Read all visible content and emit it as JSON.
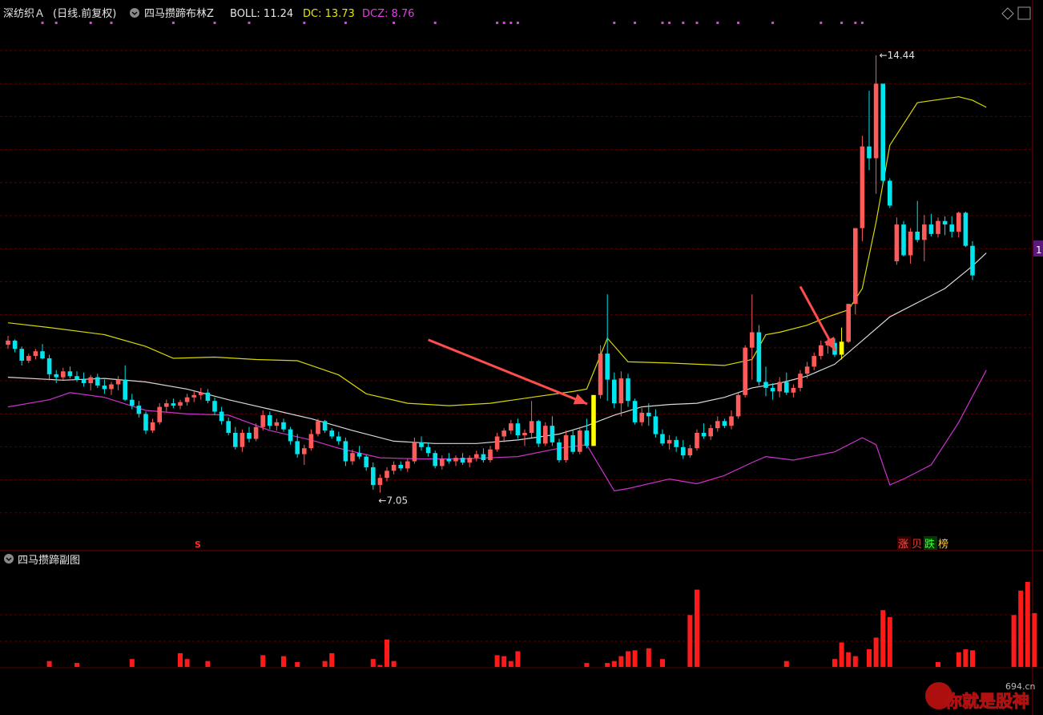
{
  "header": {
    "stock_name": "深纺织Ａ",
    "period": "(日线.前复权)",
    "indicator_name": "四马攒蹄布林Z",
    "boll_label": "BOLL: 11.24",
    "dc_label": "DC: 13.73",
    "dcz_label": "DCZ: 8.76"
  },
  "sub_panel": {
    "title": "四马攒蹄副图"
  },
  "annotations": {
    "high_label": "14.44",
    "low_label": "7.05",
    "signal_s": "S",
    "rank_labels": [
      "涨",
      "贝",
      "跌",
      "榜"
    ],
    "right_edge_label": "1"
  },
  "watermark": {
    "site": "694.cn",
    "text": "你就是股神"
  },
  "colors": {
    "background": "#000000",
    "up": "#ff5b5b",
    "down": "#00e5ee",
    "boll_mid": "#d8d8d8",
    "boll_upper": "#d8d800",
    "boll_lower": "#cc33cc",
    "grid": "#5a0000",
    "signal": "#ffff00",
    "volume": "#ff1a1a",
    "arrow": "#ff4d4d"
  },
  "chart_data": {
    "type": "candlestick",
    "title": "四马攒蹄布林Z",
    "ylim": [
      6.3,
      14.9
    ],
    "sub_ylim": [
      0,
      1
    ],
    "x": "trading day index",
    "candles": [
      [
        9.55,
        9.7,
        9.48,
        9.62
      ],
      [
        9.62,
        9.64,
        9.42,
        9.48
      ],
      [
        9.48,
        9.52,
        9.2,
        9.28
      ],
      [
        9.28,
        9.4,
        9.24,
        9.36
      ],
      [
        9.36,
        9.48,
        9.3,
        9.44
      ],
      [
        9.44,
        9.56,
        9.3,
        9.32
      ],
      [
        9.32,
        9.38,
        8.95,
        9.05
      ],
      [
        9.05,
        9.12,
        8.9,
        9.0
      ],
      [
        9.0,
        9.16,
        8.96,
        9.1
      ],
      [
        9.1,
        9.18,
        8.98,
        9.02
      ],
      [
        9.02,
        9.1,
        8.92,
        8.96
      ],
      [
        8.96,
        9.08,
        8.84,
        8.9
      ],
      [
        8.9,
        9.04,
        8.78,
        9.0
      ],
      [
        9.0,
        9.06,
        8.82,
        8.86
      ],
      [
        8.86,
        8.96,
        8.72,
        8.8
      ],
      [
        8.8,
        8.92,
        8.7,
        8.88
      ],
      [
        8.88,
        9.02,
        8.78,
        8.96
      ],
      [
        8.96,
        9.2,
        8.6,
        8.62
      ],
      [
        8.62,
        8.72,
        8.46,
        8.52
      ],
      [
        8.52,
        8.6,
        8.32,
        8.38
      ],
      [
        8.38,
        8.42,
        8.04,
        8.1
      ],
      [
        8.1,
        8.3,
        8.06,
        8.24
      ],
      [
        8.24,
        8.56,
        8.2,
        8.5
      ],
      [
        8.5,
        8.62,
        8.42,
        8.56
      ],
      [
        8.56,
        8.64,
        8.48,
        8.52
      ],
      [
        8.52,
        8.62,
        8.46,
        8.58
      ],
      [
        8.58,
        8.72,
        8.52,
        8.66
      ],
      [
        8.66,
        8.76,
        8.58,
        8.7
      ],
      [
        8.7,
        8.82,
        8.62,
        8.74
      ],
      [
        8.74,
        8.8,
        8.56,
        8.6
      ],
      [
        8.6,
        8.66,
        8.36,
        8.42
      ],
      [
        8.42,
        8.5,
        8.2,
        8.26
      ],
      [
        8.26,
        8.32,
        8.02,
        8.06
      ],
      [
        8.06,
        8.16,
        7.78,
        7.82
      ],
      [
        7.82,
        8.12,
        7.74,
        8.06
      ],
      [
        8.06,
        8.16,
        7.9,
        7.96
      ],
      [
        7.96,
        8.22,
        7.92,
        8.16
      ],
      [
        8.16,
        8.44,
        8.1,
        8.36
      ],
      [
        8.36,
        8.42,
        8.12,
        8.18
      ],
      [
        8.18,
        8.3,
        8.1,
        8.24
      ],
      [
        8.24,
        8.3,
        8.08,
        8.12
      ],
      [
        8.12,
        8.16,
        7.86,
        7.92
      ],
      [
        7.92,
        8.04,
        7.64,
        7.7
      ],
      [
        7.7,
        7.86,
        7.52,
        7.8
      ],
      [
        7.8,
        8.12,
        7.76,
        8.04
      ],
      [
        8.04,
        8.3,
        8.0,
        8.26
      ],
      [
        8.26,
        8.28,
        8.06,
        8.1
      ],
      [
        8.1,
        8.14,
        7.96,
        8.0
      ],
      [
        8.0,
        8.08,
        7.86,
        7.92
      ],
      [
        7.92,
        7.98,
        7.5,
        7.58
      ],
      [
        7.58,
        7.78,
        7.52,
        7.72
      ],
      [
        7.72,
        7.84,
        7.62,
        7.66
      ],
      [
        7.66,
        7.7,
        7.42,
        7.48
      ],
      [
        7.48,
        7.56,
        7.1,
        7.18
      ],
      [
        7.18,
        7.36,
        7.05,
        7.3
      ],
      [
        7.3,
        7.48,
        7.24,
        7.42
      ],
      [
        7.42,
        7.58,
        7.36,
        7.52
      ],
      [
        7.52,
        7.58,
        7.42,
        7.46
      ],
      [
        7.46,
        7.62,
        7.4,
        7.58
      ],
      [
        7.58,
        7.98,
        7.54,
        7.9
      ],
      [
        7.9,
        8.0,
        7.76,
        7.82
      ],
      [
        7.82,
        7.9,
        7.66,
        7.72
      ],
      [
        7.72,
        7.76,
        7.46,
        7.5
      ],
      [
        7.5,
        7.68,
        7.44,
        7.62
      ],
      [
        7.62,
        7.72,
        7.54,
        7.58
      ],
      [
        7.58,
        7.68,
        7.5,
        7.64
      ],
      [
        7.64,
        7.72,
        7.52,
        7.56
      ],
      [
        7.56,
        7.68,
        7.48,
        7.64
      ],
      [
        7.64,
        7.76,
        7.58,
        7.7
      ],
      [
        7.7,
        7.8,
        7.56,
        7.6
      ],
      [
        7.6,
        7.84,
        7.56,
        7.78
      ],
      [
        7.78,
        8.06,
        7.74,
        8.0
      ],
      [
        8.0,
        8.14,
        7.9,
        8.1
      ],
      [
        8.1,
        8.28,
        8.04,
        8.22
      ],
      [
        8.22,
        8.3,
        7.96,
        8.02
      ],
      [
        8.02,
        8.12,
        7.84,
        8.06
      ],
      [
        8.06,
        8.6,
        7.98,
        8.26
      ],
      [
        8.26,
        8.28,
        7.82,
        7.88
      ],
      [
        7.88,
        8.24,
        7.84,
        8.18
      ],
      [
        8.18,
        8.34,
        7.84,
        7.9
      ],
      [
        7.9,
        7.96,
        7.56,
        7.6
      ],
      [
        7.6,
        8.1,
        7.56,
        8.02
      ],
      [
        8.02,
        8.1,
        7.7,
        7.74
      ],
      [
        7.74,
        8.16,
        7.7,
        8.1
      ],
      [
        8.1,
        8.3,
        7.8,
        7.84
      ],
      [
        7.84,
        8.7,
        7.84,
        8.7
      ],
      [
        8.7,
        9.54,
        8.64,
        9.4
      ],
      [
        9.4,
        10.4,
        8.6,
        8.96
      ],
      [
        8.96,
        9.08,
        8.48,
        8.56
      ],
      [
        8.56,
        9.1,
        8.34,
        8.98
      ],
      [
        8.98,
        9.06,
        8.5,
        8.6
      ],
      [
        8.6,
        8.64,
        8.2,
        8.24
      ],
      [
        8.24,
        8.48,
        8.18,
        8.4
      ],
      [
        8.4,
        8.56,
        8.18,
        8.34
      ],
      [
        8.34,
        8.46,
        7.98,
        8.04
      ],
      [
        8.04,
        8.12,
        7.84,
        7.88
      ],
      [
        7.88,
        8.02,
        7.78,
        7.94
      ],
      [
        7.94,
        8.0,
        7.74,
        7.82
      ],
      [
        7.82,
        7.94,
        7.62,
        7.68
      ],
      [
        7.68,
        7.86,
        7.64,
        7.8
      ],
      [
        7.8,
        8.12,
        7.76,
        8.06
      ],
      [
        8.06,
        8.22,
        7.96,
        8.0
      ],
      [
        8.0,
        8.2,
        7.94,
        8.14
      ],
      [
        8.14,
        8.34,
        8.08,
        8.26
      ],
      [
        8.26,
        8.3,
        8.14,
        8.18
      ],
      [
        8.18,
        8.44,
        8.12,
        8.34
      ],
      [
        8.34,
        8.74,
        8.3,
        8.7
      ],
      [
        8.7,
        9.54,
        8.66,
        9.5
      ],
      [
        9.5,
        10.4,
        8.96,
        9.76
      ],
      [
        9.76,
        9.88,
        8.86,
        8.92
      ],
      [
        8.92,
        9.18,
        8.68,
        8.82
      ],
      [
        8.82,
        8.9,
        8.62,
        8.76
      ],
      [
        8.76,
        9.0,
        8.66,
        8.92
      ],
      [
        8.92,
        9.08,
        8.7,
        8.74
      ],
      [
        8.74,
        8.88,
        8.66,
        8.82
      ],
      [
        8.82,
        9.12,
        8.76,
        9.06
      ],
      [
        9.06,
        9.26,
        8.98,
        9.18
      ],
      [
        9.18,
        9.42,
        9.12,
        9.36
      ],
      [
        9.36,
        9.62,
        9.3,
        9.54
      ],
      [
        9.54,
        9.66,
        9.4,
        9.58
      ],
      [
        9.58,
        9.66,
        9.34,
        9.38
      ],
      [
        9.38,
        9.84,
        9.3,
        9.6
      ],
      [
        9.6,
        10.24,
        9.58,
        10.24
      ],
      [
        10.24,
        11.52,
        10.06,
        11.52
      ],
      [
        11.52,
        13.08,
        11.3,
        12.9
      ],
      [
        12.9,
        13.84,
        12.5,
        12.7
      ],
      [
        12.7,
        14.44,
        12.1,
        13.96
      ],
      [
        13.96,
        13.14,
        12.26,
        12.32
      ],
      [
        12.32,
        12.36,
        11.86,
        11.9
      ],
      [
        10.96,
        11.7,
        10.9,
        11.58
      ],
      [
        11.58,
        11.64,
        11.04,
        11.06
      ],
      [
        11.06,
        11.52,
        10.92,
        11.46
      ],
      [
        11.46,
        11.98,
        11.28,
        11.32
      ],
      [
        11.32,
        11.74,
        10.96,
        11.58
      ],
      [
        11.58,
        11.76,
        11.38,
        11.42
      ],
      [
        11.42,
        11.7,
        11.36,
        11.64
      ],
      [
        11.64,
        11.72,
        11.4,
        11.58
      ],
      [
        11.58,
        11.72,
        11.36,
        11.46
      ],
      [
        11.46,
        11.8,
        11.36,
        11.78
      ],
      [
        11.78,
        11.8,
        11.2,
        11.22
      ],
      [
        11.22,
        11.3,
        10.64,
        10.72
      ]
    ],
    "boll_mid": [
      [
        0,
        9.0
      ],
      [
        8,
        8.95
      ],
      [
        14,
        8.98
      ],
      [
        20,
        8.92
      ],
      [
        26,
        8.8
      ],
      [
        32,
        8.62
      ],
      [
        38,
        8.46
      ],
      [
        44,
        8.3
      ],
      [
        50,
        8.1
      ],
      [
        56,
        7.92
      ],
      [
        62,
        7.88
      ],
      [
        68,
        7.88
      ],
      [
        74,
        7.94
      ],
      [
        80,
        8.04
      ],
      [
        84,
        8.18
      ],
      [
        88,
        8.36
      ],
      [
        92,
        8.5
      ],
      [
        96,
        8.54
      ],
      [
        100,
        8.56
      ],
      [
        104,
        8.66
      ],
      [
        108,
        8.82
      ],
      [
        112,
        8.9
      ],
      [
        116,
        9.02
      ],
      [
        120,
        9.22
      ],
      [
        124,
        9.62
      ],
      [
        128,
        10.02
      ],
      [
        132,
        10.26
      ],
      [
        136,
        10.5
      ],
      [
        140,
        10.88
      ],
      [
        142,
        11.1
      ]
    ],
    "boll_upper": [
      [
        0,
        9.92
      ],
      [
        6,
        9.84
      ],
      [
        14,
        9.72
      ],
      [
        20,
        9.52
      ],
      [
        24,
        9.32
      ],
      [
        30,
        9.34
      ],
      [
        36,
        9.3
      ],
      [
        42,
        9.28
      ],
      [
        48,
        9.04
      ],
      [
        52,
        8.72
      ],
      [
        58,
        8.56
      ],
      [
        64,
        8.52
      ],
      [
        70,
        8.56
      ],
      [
        76,
        8.66
      ],
      [
        82,
        8.76
      ],
      [
        84,
        8.8
      ],
      [
        87,
        9.66
      ],
      [
        90,
        9.26
      ],
      [
        96,
        9.24
      ],
      [
        104,
        9.2
      ],
      [
        108,
        9.3
      ],
      [
        110,
        9.72
      ],
      [
        112,
        9.76
      ],
      [
        116,
        9.88
      ],
      [
        119,
        10.02
      ],
      [
        122,
        10.14
      ],
      [
        124,
        10.5
      ],
      [
        126,
        11.62
      ],
      [
        128,
        12.92
      ],
      [
        132,
        13.64
      ],
      [
        138,
        13.74
      ],
      [
        140,
        13.68
      ],
      [
        142,
        13.56
      ]
    ],
    "boll_lower": [
      [
        0,
        8.5
      ],
      [
        6,
        8.62
      ],
      [
        9,
        8.74
      ],
      [
        14,
        8.66
      ],
      [
        20,
        8.44
      ],
      [
        26,
        8.38
      ],
      [
        32,
        8.36
      ],
      [
        38,
        8.1
      ],
      [
        44,
        7.94
      ],
      [
        48,
        7.8
      ],
      [
        54,
        7.64
      ],
      [
        60,
        7.62
      ],
      [
        66,
        7.62
      ],
      [
        74,
        7.66
      ],
      [
        80,
        7.8
      ],
      [
        84,
        7.86
      ],
      [
        88,
        7.08
      ],
      [
        90,
        7.12
      ],
      [
        96,
        7.28
      ],
      [
        100,
        7.2
      ],
      [
        104,
        7.34
      ],
      [
        108,
        7.56
      ],
      [
        110,
        7.66
      ],
      [
        114,
        7.6
      ],
      [
        120,
        7.74
      ],
      [
        124,
        7.98
      ],
      [
        126,
        7.86
      ],
      [
        128,
        7.18
      ],
      [
        130,
        7.28
      ],
      [
        134,
        7.52
      ],
      [
        138,
        8.24
      ],
      [
        142,
        9.12
      ]
    ],
    "volume": [
      0,
      0,
      0,
      0,
      0,
      0,
      0.06,
      0,
      0,
      0,
      0.04,
      0,
      0,
      0,
      0,
      0,
      0,
      0,
      0.08,
      0,
      0,
      0,
      0,
      0,
      0,
      0.14,
      0.08,
      0,
      0,
      0.06,
      0,
      0,
      0,
      0,
      0,
      0,
      0,
      0.12,
      0,
      0,
      0.11,
      0,
      0.05,
      0,
      0,
      0,
      0.06,
      0.14,
      0,
      0,
      0,
      0,
      0,
      0.08,
      0.02,
      0.28,
      0.06,
      0,
      0,
      0,
      0,
      0,
      0,
      0,
      0,
      0,
      0,
      0,
      0,
      0,
      0,
      0.12,
      0.11,
      0.06,
      0.16,
      0,
      0,
      0,
      0,
      0,
      0,
      0,
      0,
      0,
      0.04,
      0,
      0,
      0.04,
      0.06,
      0.11,
      0.16,
      0.17,
      0,
      0.19,
      0,
      0.08,
      0,
      0,
      0,
      0.53,
      0.79,
      0,
      0,
      0,
      0,
      0,
      0,
      0,
      0,
      0,
      0,
      0,
      0,
      0.06,
      0,
      0,
      0,
      0,
      0,
      0,
      0.08,
      0.25,
      0.15,
      0.11,
      0,
      0.18,
      0.3,
      0.58,
      0.51,
      0,
      0,
      0,
      0,
      0,
      0,
      0.05,
      0,
      0,
      0.15,
      0.18,
      0.17,
      0,
      0,
      0,
      0,
      0,
      0.53,
      0.78,
      0.87,
      0.55,
      0,
      0,
      0,
      0,
      0,
      0.04,
      0,
      0.03,
      0.04,
      0,
      0.13,
      0
    ],
    "volume_highlight_idx": [
      23,
      60
    ],
    "signal_candles": [
      85,
      121
    ],
    "signal_arrows": [
      [
        61,
        85
      ],
      [
        115,
        121
      ]
    ],
    "top_markers": [
      5,
      7,
      12,
      15,
      24,
      30,
      35,
      43,
      49,
      56,
      62,
      71,
      72,
      73,
      74,
      88,
      91,
      95,
      96,
      98,
      100,
      103,
      106,
      111,
      118,
      121,
      123,
      124
    ],
    "high_idx": 126,
    "low_idx": 54
  }
}
